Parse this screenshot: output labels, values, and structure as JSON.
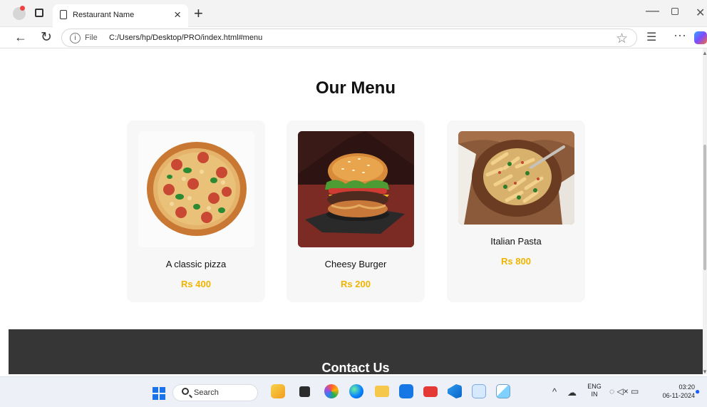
{
  "browser": {
    "tab_title": "Restaurant Name",
    "tab_close": "×",
    "new_tab": "+",
    "nav_back": "←",
    "nav_refresh": "↻",
    "address_prefix": "File",
    "url": "C:/Users/hp/Desktop/PRO/index.html#menu",
    "star": "☆",
    "favorites": "☰",
    "more": "···",
    "window_minimize": "—",
    "window_close": "✕"
  },
  "page": {
    "heading": "Our Menu",
    "items": [
      {
        "name": "A classic pizza",
        "price": "Rs 400",
        "image": "pizza-image"
      },
      {
        "name": "Cheesy Burger",
        "price": "Rs 200",
        "image": "burger-image"
      },
      {
        "name": "Italian Pasta",
        "price": "Rs 800",
        "image": "pasta-image"
      }
    ],
    "contact_heading": "Contact Us"
  },
  "taskbar": {
    "search_label": "Search",
    "tray_chevron": "^",
    "tray_cloud": "☁",
    "language_line1": "ENG",
    "language_line2": "IN",
    "tray_status": "◌ ◁× ▭",
    "time": "03:20",
    "date": "06-11-2024",
    "notification": "●",
    "icons": [
      "yellow-widget-icon",
      "dark-square-icon",
      "colorful-swirl-icon",
      "edge-icon",
      "folder-icon",
      "store-icon",
      "youtube-icon",
      "vscode-icon",
      "notepad-icon",
      "paint-icon"
    ],
    "accent_colors": {
      "start": "#1a73e8",
      "price": "#f0b400",
      "contact_bg": "#363636"
    }
  }
}
